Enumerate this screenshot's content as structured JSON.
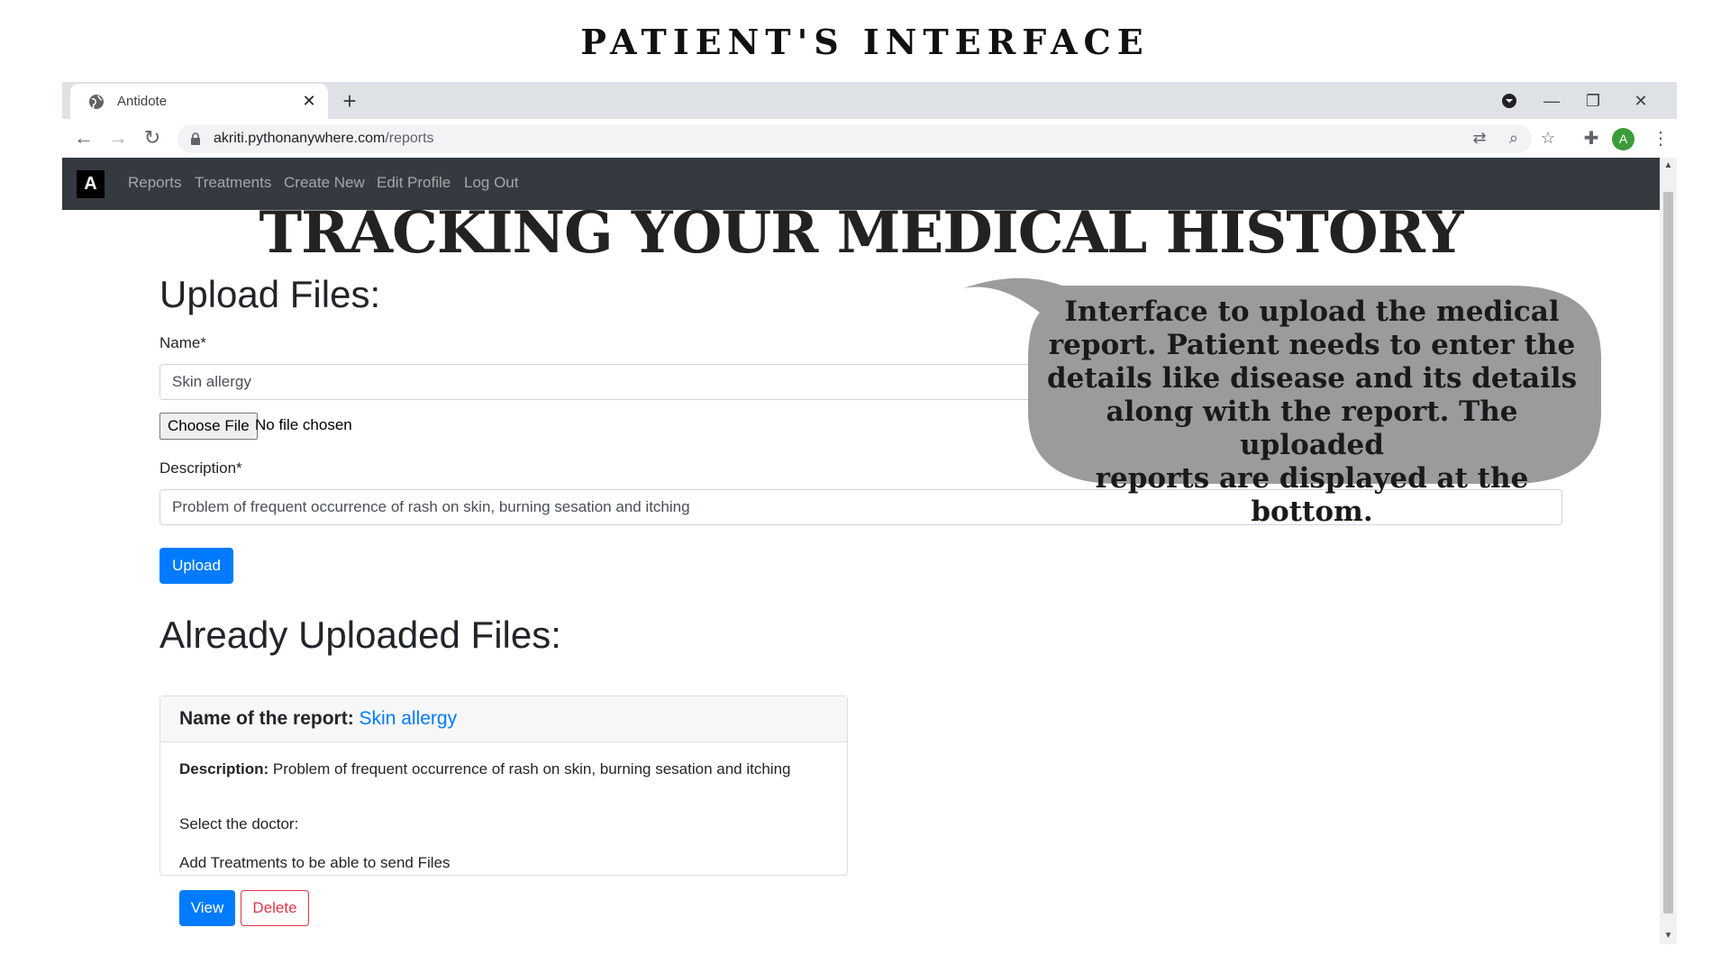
{
  "slide": {
    "title": "PATIENT'S INTERFACE"
  },
  "browser": {
    "tab_title": "Antidote",
    "url_host": "akriti.pythonanywhere.com",
    "url_path": "/reports",
    "profile_initial": "A"
  },
  "app": {
    "brand": "A",
    "nav": [
      "Reports",
      "Treatments",
      "Create New",
      "Edit Profile",
      "Log Out"
    ],
    "hero_title": "TRACKING YOUR MEDICAL HISTORY"
  },
  "upload": {
    "heading": "Upload Files:",
    "name_label": "Name*",
    "name_value": "Skin allergy",
    "file_button": "Choose File",
    "file_status": "No file chosen",
    "description_label": "Description*",
    "description_value": "Problem of frequent occurrence of rash on skin, burning sesation and itching",
    "submit_label": "Upload"
  },
  "uploaded": {
    "heading": "Already Uploaded Files:",
    "card": {
      "name_prefix": "Name of the report:",
      "name_link": "Skin allergy",
      "description_prefix": "Description:",
      "description": "Problem of frequent occurrence of rash on skin, burning sesation and itching",
      "select_doctor": "Select the doctor:",
      "treatments_note": "Add Treatments to be able to send Files",
      "view_label": "View",
      "delete_label": "Delete"
    }
  },
  "callout": {
    "lines": [
      "Interface to upload the medical",
      "report. Patient needs to enter the",
      "details like disease and its details",
      "along with the report. The uploaded",
      "reports are displayed at the bottom."
    ]
  },
  "colors": {
    "navbar": "#343a40",
    "primary": "#007bff",
    "danger": "#dc3545",
    "bubble": "#9a9b9d"
  }
}
